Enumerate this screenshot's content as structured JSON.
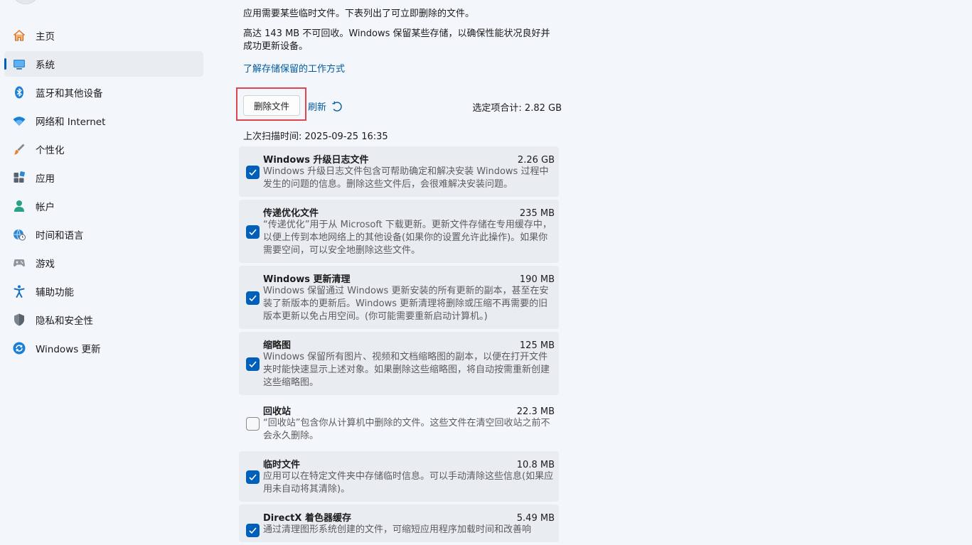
{
  "sidebar": {
    "items": [
      {
        "label": "主页",
        "icon": "home-icon",
        "selected": false
      },
      {
        "label": "系统",
        "icon": "system-display-icon",
        "selected": true
      },
      {
        "label": "蓝牙和其他设备",
        "icon": "bluetooth-icon",
        "selected": false
      },
      {
        "label": "网络和 Internet",
        "icon": "wifi-icon",
        "selected": false
      },
      {
        "label": "个性化",
        "icon": "paintbrush-icon",
        "selected": false
      },
      {
        "label": "应用",
        "icon": "apps-icon",
        "selected": false
      },
      {
        "label": "帐户",
        "icon": "account-icon",
        "selected": false
      },
      {
        "label": "时间和语言",
        "icon": "globe-clock-icon",
        "selected": false
      },
      {
        "label": "游戏",
        "icon": "gamepad-icon",
        "selected": false
      },
      {
        "label": "辅助功能",
        "icon": "accessibility-icon",
        "selected": false
      },
      {
        "label": "隐私和安全性",
        "icon": "shield-icon",
        "selected": false
      },
      {
        "label": "Windows 更新",
        "icon": "windows-update-icon",
        "selected": false
      }
    ]
  },
  "main": {
    "intro_line1": "应用需要某些临时文件。下表列出了可立即删除的文件。",
    "intro_line2": "高达 143 MB 不可回收。Windows 保留某些存储，以确保性能状况良好并成功更新设备。",
    "learn_link": "了解存储保留的工作方式",
    "delete_button": "删除文件",
    "refresh_label": "刷新",
    "selected_total": "选定项合计: 2.82 GB",
    "last_scan": "上次扫描时间: 2025-09-25 16:35",
    "files": [
      {
        "title": "Windows 升级日志文件",
        "size": "2.26 GB",
        "checked": true,
        "desc": "Windows 升级日志文件包含可帮助确定和解决安装 Windows 过程中发生的问题的信息。删除这些文件后，会很难解决安装问题。"
      },
      {
        "title": "传递优化文件",
        "size": "235 MB",
        "checked": true,
        "desc": "“传递优化”用于从 Microsoft 下载更新。更新文件存储在专用缓存中，以便上传到本地网络上的其他设备(如果你的设置允许此操作)。如果你需要空间，可以安全地删除这些文件。"
      },
      {
        "title": "Windows 更新清理",
        "size": "190 MB",
        "checked": true,
        "desc": "Windows 保留通过 Windows 更新安装的所有更新的副本，甚至在安装了新版本的更新后。Windows 更新清理将删除或压缩不再需要的旧版本更新以免占用空间。(你可能需要重新启动计算机。)"
      },
      {
        "title": "缩略图",
        "size": "125 MB",
        "checked": true,
        "desc": "Windows 保留所有图片、视频和文档缩略图的副本，以便在打开文件夹时能快速显示上述对象。如果删除这些缩略图，将自动按需重新创建这些缩略图。"
      },
      {
        "title": "回收站",
        "size": "22.3 MB",
        "checked": false,
        "desc": "“回收站”包含你从计算机中删除的文件。这些文件在清空回收站之前不会永久删除。"
      },
      {
        "title": "临时文件",
        "size": "10.8 MB",
        "checked": true,
        "desc": "应用可以在特定文件夹中存储临时信息。可以手动清除这些信息(如果应用未自动将其清除)。"
      },
      {
        "title": "DirectX 着色器缓存",
        "size": "5.49 MB",
        "checked": true,
        "desc": "通过清理图形系统创建的文件，可缩短应用程序加载时间和改善响"
      }
    ]
  },
  "colors": {
    "accent": "#005fb8",
    "link": "#005a9e",
    "highlight_border": "#e0454d",
    "row_bg": "#e9ecf1",
    "page_bg": "#f3f6fa"
  }
}
